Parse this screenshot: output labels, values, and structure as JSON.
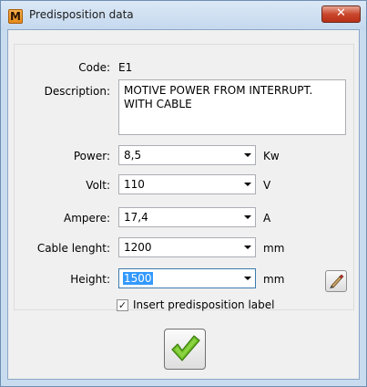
{
  "window": {
    "title": "Predisposition data",
    "app_icon_letter": "M"
  },
  "form": {
    "code": {
      "label": "Code:",
      "value": "E1"
    },
    "description": {
      "label": "Description:",
      "value": "MOTIVE POWER FROM INTERRUPT. WITH CABLE"
    },
    "power": {
      "label": "Power:",
      "value": "8,5",
      "unit": "Kw"
    },
    "volt": {
      "label": "Volt:",
      "value": "110",
      "unit": "V"
    },
    "ampere": {
      "label": "Ampere:",
      "value": "17,4",
      "unit": "A"
    },
    "cable": {
      "label": "Cable lenght:",
      "value": "1200",
      "unit": "mm"
    },
    "height": {
      "label": "Height:",
      "value": "1500",
      "unit": "mm"
    },
    "insert_label": {
      "label": "Insert predisposition label",
      "checked": true
    }
  },
  "icons": {
    "close": "close-icon",
    "edit": "pencil-brush-icon",
    "ok": "green-checkmark-icon"
  },
  "colors": {
    "ok_check": "#5aa81e",
    "selection": "#3399ff",
    "close_button": "#c9482d"
  }
}
